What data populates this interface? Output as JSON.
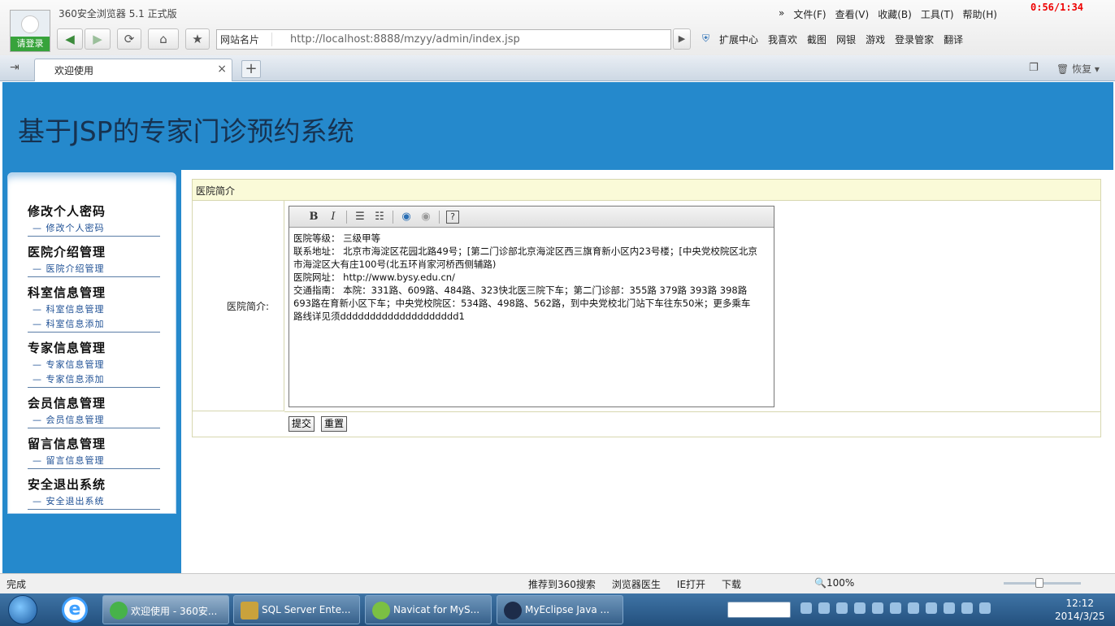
{
  "browser": {
    "login_label": "请登录",
    "app_title": "360安全浏览器 5.1 正式版",
    "menus": [
      "文件(F)",
      "查看(V)",
      "收藏(B)",
      "工具(T)",
      "帮助(H)"
    ],
    "timer": "0:56/1:34",
    "site_menu": "网站名片",
    "address": "http://localhost:8888/mzyy/admin/index.jsp",
    "toolbar": [
      "扩展中心",
      "我喜欢",
      "截图",
      "网银",
      "游戏",
      "登录管家",
      "翻译"
    ],
    "tab_title": "欢迎使用",
    "restore_label": "恢复",
    "status_left": "完成",
    "status_items": [
      "推荐到360搜索",
      "浏览器医生",
      "IE打开",
      "下载"
    ],
    "zoom": "100%"
  },
  "page": {
    "title": "基于JSP的专家门诊预约系统",
    "sidebar": [
      {
        "head": "修改个人密码",
        "items": [
          "修改个人密码"
        ]
      },
      {
        "head": "医院介绍管理",
        "items": [
          "医院介绍管理"
        ]
      },
      {
        "head": "科室信息管理",
        "items": [
          "科室信息管理",
          "科室信息添加"
        ]
      },
      {
        "head": "专家信息管理",
        "items": [
          "专家信息管理",
          "专家信息添加"
        ]
      },
      {
        "head": "会员信息管理",
        "items": [
          "会员信息管理"
        ]
      },
      {
        "head": "留言信息管理",
        "items": [
          "留言信息管理"
        ]
      },
      {
        "head": "安全退出系统",
        "items": [
          "安全退出系统"
        ]
      }
    ],
    "panel_title": "医院简介",
    "field_label": "医院简介:",
    "editor_lines": [
      "医院等级： 三级甲等",
      "联系地址： 北京市海淀区花园北路49号；[第二门诊部北京海淀区西三旗育新小区内23号楼；[中央党校院区北京市海淀区大有庄100号(北五环肖家河桥西侧辅路)",
      "医院网址： http://www.bysy.edu.cn/",
      "交通指南： 本院：331路、609路、484路、323快北医三院下车；第二门诊部：355路 379路 393路 398路 693路在育新小区下车；中央党校院区：534路、498路、562路，到中央党校北门站下车往东50米；更多乘车路线详见须dddddddddddddddddddd1"
    ],
    "submit_label": "提交",
    "reset_label": "重置"
  },
  "taskbar": {
    "windows": [
      "欢迎使用 - 360安...",
      "SQL Server Ente...",
      "Navicat for MyS...",
      "MyEclipse Java ..."
    ],
    "time": "12:12",
    "date": "2014/3/25"
  }
}
